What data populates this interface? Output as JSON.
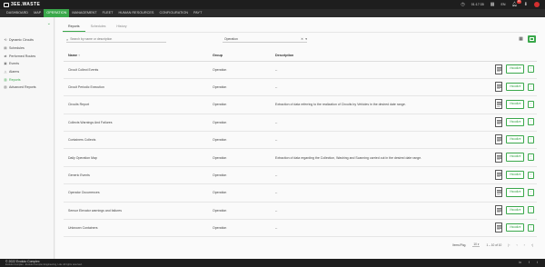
{
  "app": {
    "logo_text": "3EE.WASTE"
  },
  "topbar": {
    "time": "01:17:35",
    "language": "EN",
    "notifications_count": "10"
  },
  "nav": {
    "items": [
      {
        "label": "DASHBOARD"
      },
      {
        "label": "MAP"
      },
      {
        "label": "OPERATION",
        "active": true
      },
      {
        "label": "MANAGEMENT"
      },
      {
        "label": "FLEET"
      },
      {
        "label": "HUMAN RESOURCES"
      },
      {
        "label": "CONFIGURATION"
      },
      {
        "label": "PAYT"
      }
    ]
  },
  "sidebar": {
    "items": [
      {
        "label": "Dynamic Circuits",
        "icon": "circuit-icon"
      },
      {
        "label": "Schedules",
        "icon": "calendar-icon"
      },
      {
        "label": "Performed Routes",
        "icon": "route-icon"
      },
      {
        "label": "Events",
        "icon": "event-icon"
      },
      {
        "label": "Alarms",
        "icon": "alarm-icon"
      },
      {
        "label": "Reports",
        "icon": "report-icon",
        "active": true
      },
      {
        "label": "Advanced Reports",
        "icon": "advanced-report-icon"
      }
    ]
  },
  "tabs": [
    {
      "label": "Reports",
      "active": true
    },
    {
      "label": "Schedules"
    },
    {
      "label": "History"
    }
  ],
  "search": {
    "placeholder": "Search by name or description"
  },
  "filter": {
    "value": "Operation"
  },
  "table": {
    "headers": {
      "name": "Name ↑",
      "group": "Group",
      "description": "Description"
    },
    "action_label": "Visualize",
    "rows": [
      {
        "name": "Circuit Collect Events",
        "group": "Operation",
        "description": "--"
      },
      {
        "name": "Circuit Periodic Execution",
        "group": "Operation",
        "description": "--"
      },
      {
        "name": "Circuits Report",
        "group": "Operation",
        "description": "Extraction of data referring to the realization of Circuits by Vehicles in the desired date range."
      },
      {
        "name": "Collects Warnings And Failures",
        "group": "Operation",
        "description": "--"
      },
      {
        "name": "Containers Collects",
        "group": "Operation",
        "description": "--"
      },
      {
        "name": "Daily Operation Map",
        "group": "Operation",
        "description": "Extraction of data regarding the Collection, Washing and Scanning carried out in the desired date range."
      },
      {
        "name": "Generic Events",
        "group": "Operation",
        "description": "--"
      },
      {
        "name": "Operator Occurrences",
        "group": "Operation",
        "description": "--"
      },
      {
        "name": "Sensor Elevator warnings and failures",
        "group": "Operation",
        "description": "--"
      },
      {
        "name": "Unknown Containers",
        "group": "Operation",
        "description": "--"
      }
    ]
  },
  "pagination": {
    "items_per_page_label": "Items/Pág.",
    "items_per_page": "10",
    "range": "1 – 10 of 10"
  },
  "footer": {
    "copyright": "© 2022 Evoluto Complex",
    "sub": "Evoluto Complex - Evoluto Complex Engineering, Lda. All rights reserved."
  },
  "colors": {
    "accent": "#3aa84b",
    "topbar": "#1e1e1e",
    "nav": "#2b2b2b",
    "badge": "#e53935"
  }
}
